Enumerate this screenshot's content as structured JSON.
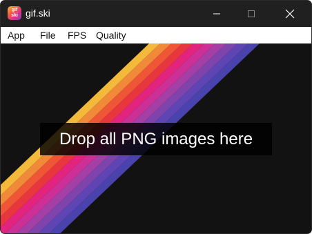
{
  "window": {
    "title": "gif.ski",
    "app_icon": "gif-ski-logo-icon",
    "app_icon_text": "gif ski"
  },
  "menu": {
    "items": [
      {
        "label": "App"
      },
      {
        "label": "File"
      },
      {
        "label": "FPS"
      },
      {
        "label": "Quality"
      }
    ]
  },
  "main": {
    "drop_text": "Drop all PNG images here"
  },
  "colors": {
    "stripes": [
      "#f2b93a",
      "#f08a38",
      "#ee5636",
      "#e8363f",
      "#e2247e",
      "#cc3097",
      "#a43fa5",
      "#7f44ac",
      "#5e45b3",
      "#4a42ad"
    ],
    "background": "#121212"
  }
}
